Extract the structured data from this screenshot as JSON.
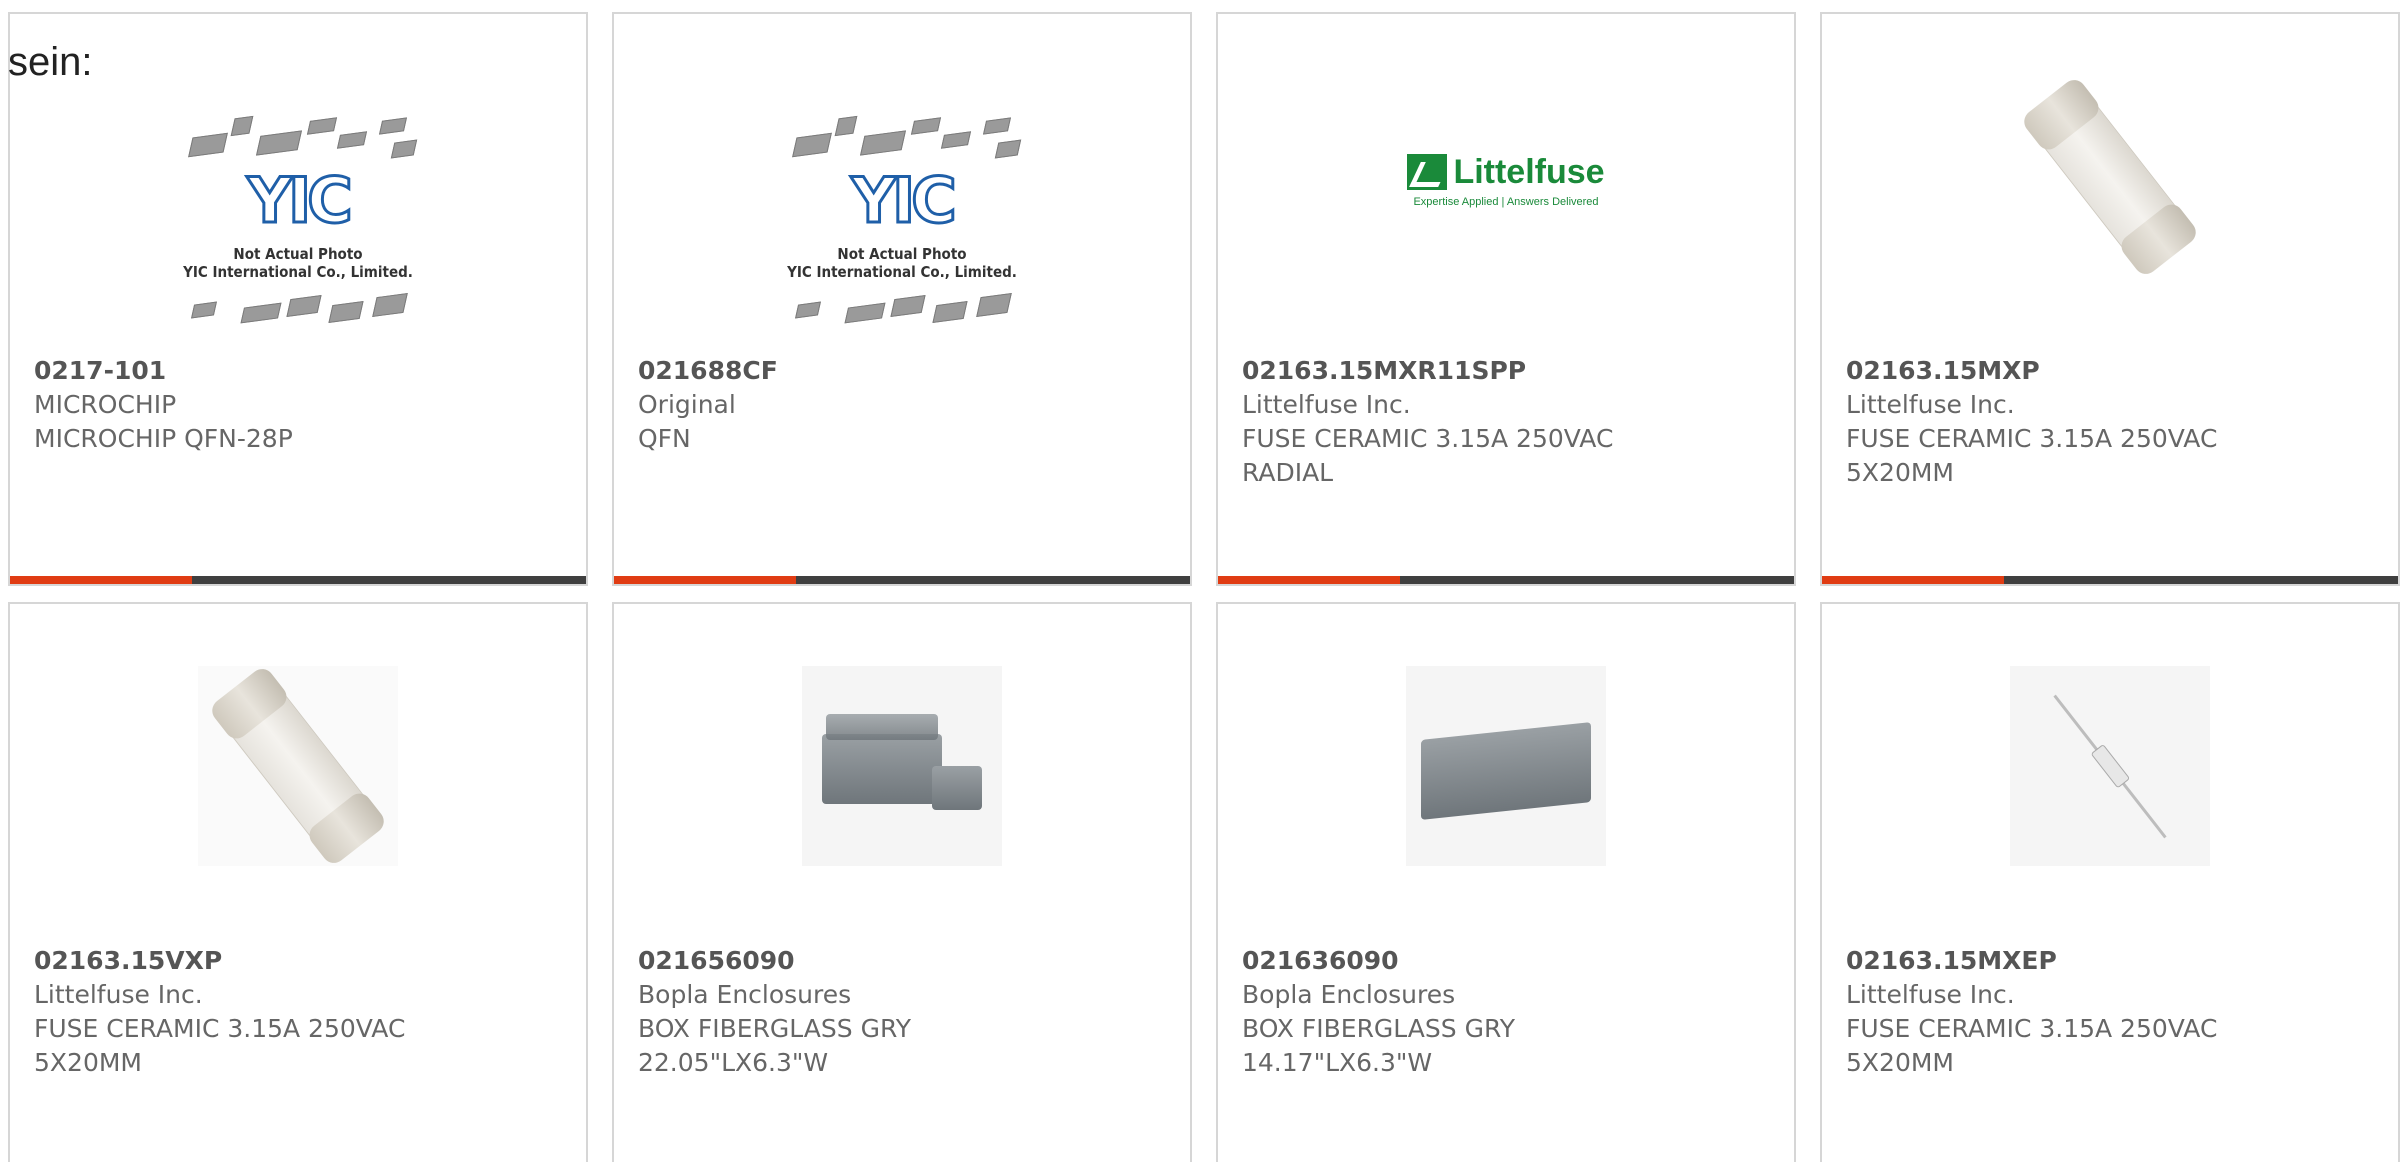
{
  "heading": "sein:",
  "brand_colors": {
    "accent": "#e03c13",
    "bar": "#3f3f3f",
    "border": "#d6d6d6"
  },
  "products": [
    {
      "image": "yic-placeholder",
      "placeholder_text": [
        "Not Actual Photo",
        "YIC International Co., Limited."
      ],
      "part": "0217-101",
      "manufacturer": "MICROCHIP",
      "description": "MICROCHIP QFN-28P"
    },
    {
      "image": "yic-placeholder",
      "placeholder_text": [
        "Not Actual Photo",
        "YIC International Co., Limited."
      ],
      "part": "021688CF",
      "manufacturer": "Original",
      "description": "QFN"
    },
    {
      "image": "littelfuse-logo",
      "logo_text": [
        "Littelfuse",
        "Expertise Applied | Answers Delivered"
      ],
      "part": "02163.15MXR11SPP",
      "manufacturer": "Littelfuse Inc.",
      "description": "FUSE CERAMIC 3.15A 250VAC RADIAL"
    },
    {
      "image": "fuse-photo",
      "part": "02163.15MXP",
      "manufacturer": "Littelfuse Inc.",
      "description": "FUSE CERAMIC 3.15A 250VAC 5X20MM"
    },
    {
      "image": "fuse-photo",
      "part": "02163.15VXP",
      "manufacturer": "Littelfuse Inc.",
      "description": "FUSE CERAMIC 3.15A 250VAC 5X20MM"
    },
    {
      "image": "enclosure-photo",
      "part": "021656090",
      "manufacturer": "Bopla Enclosures",
      "description": "BOX FIBERGLASS GRY 22.05\"LX6.3\"W"
    },
    {
      "image": "enclosure-photo",
      "part": "021636090",
      "manufacturer": "Bopla Enclosures",
      "description": "BOX FIBERGLASS GRY 14.17\"LX6.3\"W"
    },
    {
      "image": "axial-fuse-photo",
      "part": "02163.15MXEP",
      "manufacturer": "Littelfuse Inc.",
      "description": "FUSE CERAMIC 3.15A 250VAC 5X20MM"
    }
  ]
}
